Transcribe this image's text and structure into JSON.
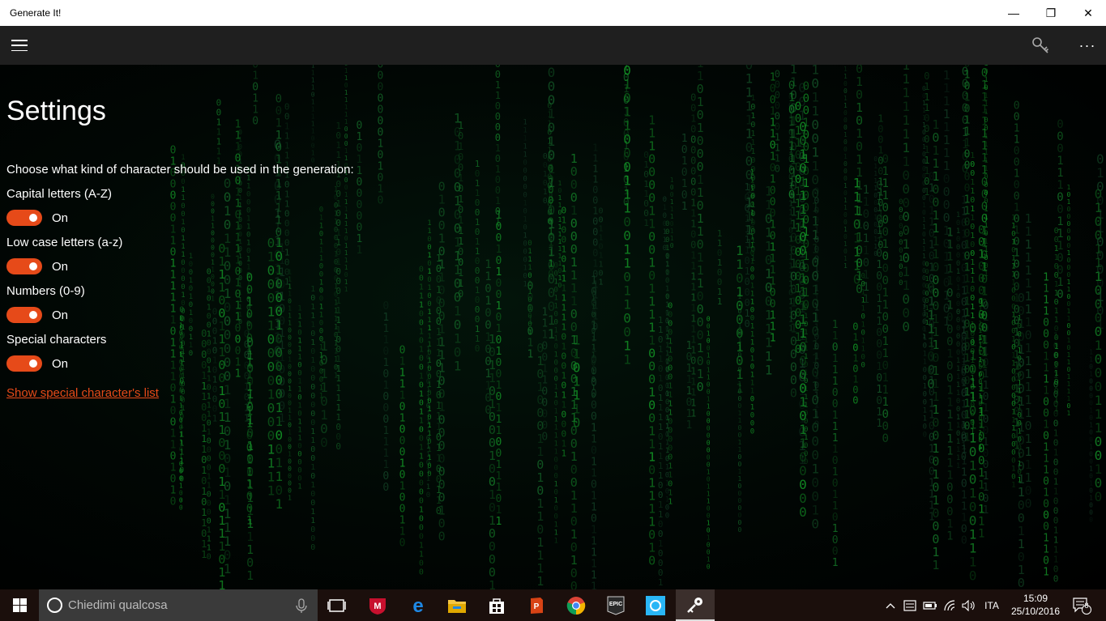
{
  "window": {
    "title": "Generate It!",
    "minimize": "—",
    "restore": "❐",
    "close": "✕"
  },
  "appbar": {
    "menu_icon": "hamburger-icon",
    "key_icon": "key-icon",
    "more": "···"
  },
  "settings": {
    "title": "Settings",
    "intro": "Choose what kind of character should be used in the generation:",
    "options": [
      {
        "label": "Capital letters (A-Z)",
        "state": "On"
      },
      {
        "label": "Low case letters (a-z)",
        "state": "On"
      },
      {
        "label": "Numbers (0-9)",
        "state": "On"
      },
      {
        "label": "Special characters",
        "state": "On"
      }
    ],
    "show_list_link": "Show special character's list",
    "accent_color": "#e64a19"
  },
  "taskbar": {
    "search_placeholder": "Chiedimi qualcosa",
    "language": "ITA",
    "time": "15:09",
    "date": "25/10/2016",
    "notification_count": "8",
    "apps": [
      "task-view-icon",
      "mcafee-icon",
      "edge-icon",
      "file-explorer-icon",
      "store-icon",
      "office-icon",
      "chrome-icon",
      "epic-games-icon",
      "sync-app-icon",
      "generate-it-icon"
    ]
  }
}
